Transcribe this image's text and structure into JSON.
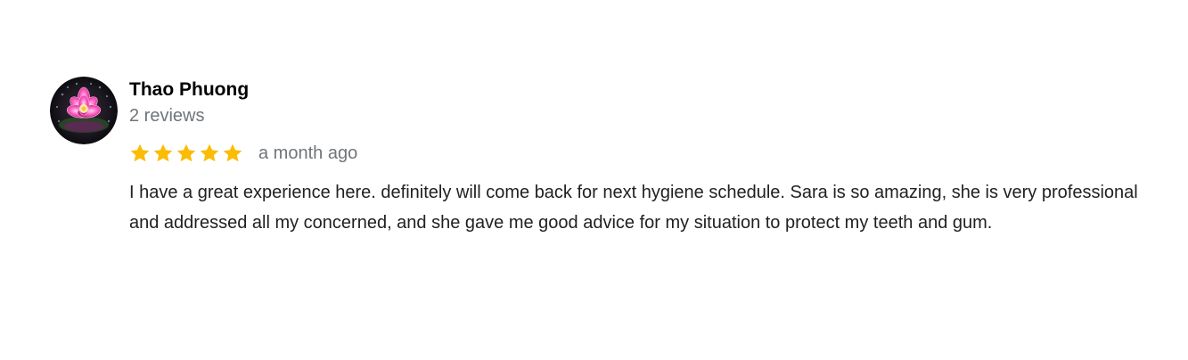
{
  "review": {
    "author": {
      "name": "Thao Phuong",
      "review_count": "2 reviews",
      "avatar_icon": "lotus-flower-avatar"
    },
    "rating": {
      "stars": 5,
      "max_stars": 5,
      "star_color": "#fbbc04",
      "icon": "star-icon"
    },
    "time": "a month ago",
    "text": "I have a great experience here. definitely will come back for next hygiene schedule. Sara is so amazing, she is very professional and addressed all my concerned, and she gave me good advice for my situation to protect my teeth and gum."
  },
  "colors": {
    "name": "#000000",
    "secondary": "#70757a",
    "body_text": "#202124"
  }
}
